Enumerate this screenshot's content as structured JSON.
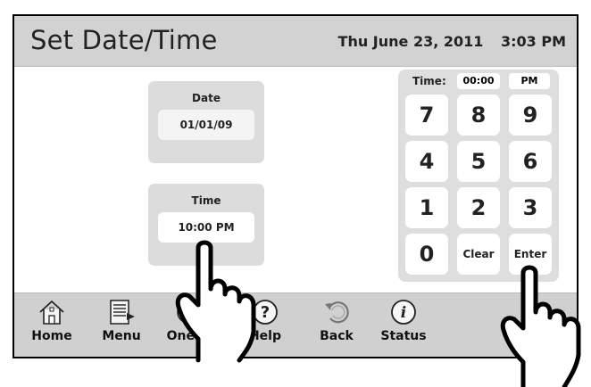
{
  "header": {
    "title": "Set Date/Time",
    "date": "Thu June 23, 2011",
    "time": "3:03 PM"
  },
  "date_panel": {
    "label": "Date",
    "value": "01/01/09"
  },
  "time_panel": {
    "label": "Time",
    "value": "10:00 PM"
  },
  "keypad": {
    "time_label": "Time:",
    "time_value": "00:00",
    "ampm": "PM",
    "keys": [
      "7",
      "8",
      "9",
      "4",
      "5",
      "6",
      "1",
      "2",
      "3",
      "0",
      "Clear",
      "Enter"
    ]
  },
  "nav": {
    "items": [
      {
        "label": "Home",
        "icon": "home-icon"
      },
      {
        "label": "Menu",
        "icon": "menu-icon"
      },
      {
        "label": "OneTo",
        "icon": "onetouch-icon"
      },
      {
        "label": "Help",
        "icon": "help-icon"
      },
      {
        "label": "Back",
        "icon": "back-icon"
      },
      {
        "label": "Status",
        "icon": "status-icon"
      }
    ]
  },
  "colors": {
    "header_bg": "#d2d2d2",
    "panel_bg": "#dcdcdc",
    "navbar_bg": "#d0d0d0",
    "text": "#222222"
  }
}
